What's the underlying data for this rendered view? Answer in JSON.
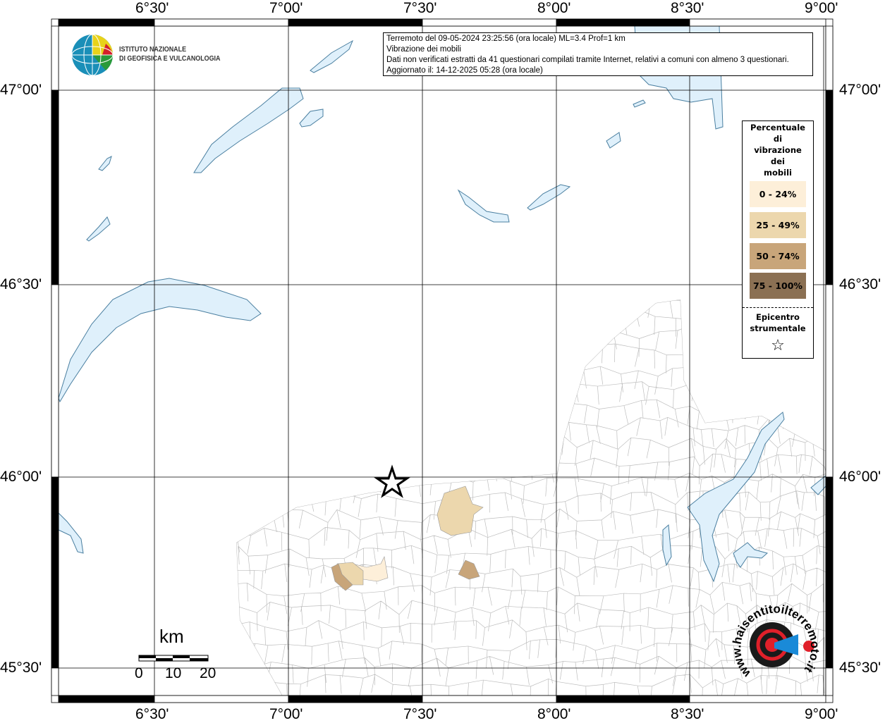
{
  "info_box": {
    "line1": "Terremoto del 09-05-2024 23:25:56 (ora locale) ML=3.4 Prof=1 km",
    "line2": "Vibrazione dei mobili",
    "line3": "Dati non verificati estratti da 41 questionari compilati tramite Internet, relativi a comuni con almeno 3 questionari.",
    "line4": "Aggiornato il: 14-12-2025 05:28 (ora locale)"
  },
  "logo": {
    "line1": "ISTITUTO NAZIONALE",
    "line2": "DI GEOFISICA E VULCANOLOGIA"
  },
  "logo_hsit": "www.haisentitoilterremoto.it",
  "axes": {
    "lon_ticks": [
      "6°30'",
      "7°00'",
      "7°30'",
      "8°00'",
      "8°30'",
      "9°00'"
    ],
    "lat_ticks": [
      "47°00'",
      "46°30'",
      "46°00'",
      "45°30'"
    ]
  },
  "legend": {
    "title": [
      "Percentuale",
      "di",
      "vibrazione",
      "dei",
      "mobili"
    ],
    "classes": [
      {
        "label": "0 - 24%",
        "color": "#fdefd9"
      },
      {
        "label": "25 - 49%",
        "color": "#ecd7ad"
      },
      {
        "label": "50 - 74%",
        "color": "#c8a57a"
      },
      {
        "label": "75 - 100%",
        "color": "#8b7053"
      }
    ],
    "epicenter_label": [
      "Epicentro",
      "strumentale"
    ],
    "epicenter_symbol": "☆"
  },
  "scale_bar": {
    "unit": "km",
    "labels": [
      "0",
      "10",
      "20"
    ]
  },
  "colors": {
    "lake": "#dff0fb",
    "lake_border": "#4a7fa0",
    "boundary": "#b8b8b8"
  }
}
